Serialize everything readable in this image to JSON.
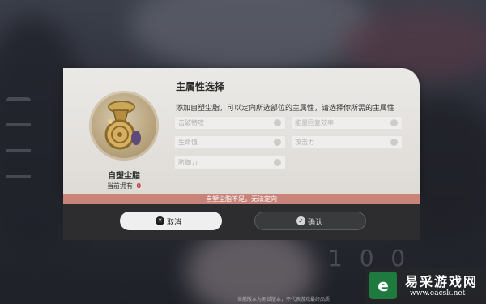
{
  "dialog": {
    "title": "主属性选择",
    "description": "添加自塑尘脂，可以定向所选部位的主属性，请选择你所需的主属性",
    "options": [
      {
        "label": "击破特攻"
      },
      {
        "label": "能量回复效率"
      },
      {
        "label": "生命值"
      },
      {
        "label": "攻击力"
      },
      {
        "label": "防御力"
      }
    ],
    "item": {
      "name": "自塑尘脂",
      "count_label": "当前拥有",
      "count": "0"
    },
    "warning": "自塑尘脂不足，无法定向",
    "buttons": {
      "cancel": "取消",
      "confirm": "确认"
    }
  },
  "footer_note": "当前版本为测试版本，不代表游戏最终品质",
  "watermark": {
    "title": "易采游戏网",
    "url": "www.eacsk.net"
  }
}
